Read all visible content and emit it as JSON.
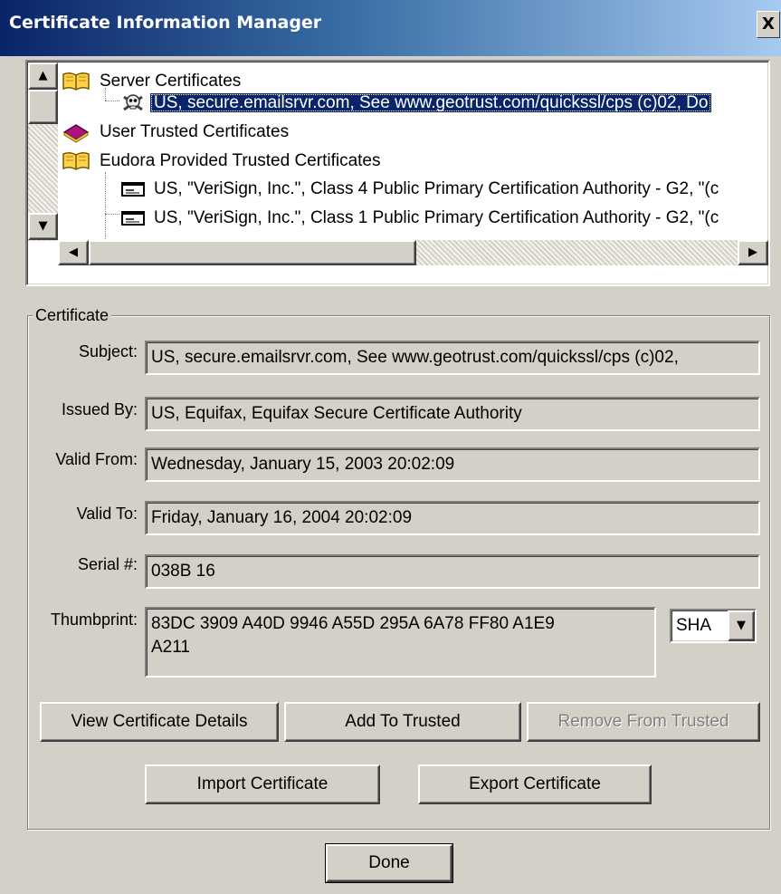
{
  "window": {
    "title": "Certificate Information Manager",
    "close_label": "X"
  },
  "tree": {
    "nodes": [
      {
        "label": "Server Certificates",
        "icon": "open-book-icon"
      },
      {
        "label": "US, secure.emailsrvr.com, See www.geotrust.com/quickssl/cps (c)02, Do",
        "icon": "skull-crossbones-icon",
        "selected": true
      },
      {
        "label": "User Trusted Certificates",
        "icon": "closed-book-icon"
      },
      {
        "label": "Eudora Provided Trusted Certificates",
        "icon": "open-book-icon"
      },
      {
        "label": "US, \"VeriSign, Inc.\", Class 4 Public Primary Certification Authority - G2, \"(c",
        "icon": "certificate-card-icon"
      },
      {
        "label": "US, \"VeriSign, Inc.\", Class 1 Public Primary Certification Authority - G2, \"(c",
        "icon": "certificate-card-icon"
      }
    ]
  },
  "certificate": {
    "group_label": "Certificate",
    "subject_label": "Subject:",
    "subject_value": "US, secure.emailsrvr.com, See www.geotrust.com/quickssl/cps (c)02,",
    "issued_by_label": "Issued By:",
    "issued_by_value": "US, Equifax, Equifax Secure Certificate Authority",
    "valid_from_label": "Valid From:",
    "valid_from_value": "Wednesday, January 15, 2003 20:02:09",
    "valid_to_label": "Valid To:",
    "valid_to_value": "Friday, January 16, 2004 20:02:09",
    "serial_label": "Serial #:",
    "serial_value": "038B 16",
    "thumbprint_label": "Thumbprint:",
    "thumbprint_line1": "83DC 3909 A40D 9946 A55D 295A 6A78 FF80 A1E9",
    "thumbprint_line2": "A211",
    "hash_selected": "SHA"
  },
  "buttons": {
    "view_details": "View Certificate Details",
    "add_trusted": "Add To Trusted",
    "remove_trusted": "Remove From Trusted",
    "import": "Import Certificate",
    "export": "Export Certificate",
    "done": "Done"
  }
}
